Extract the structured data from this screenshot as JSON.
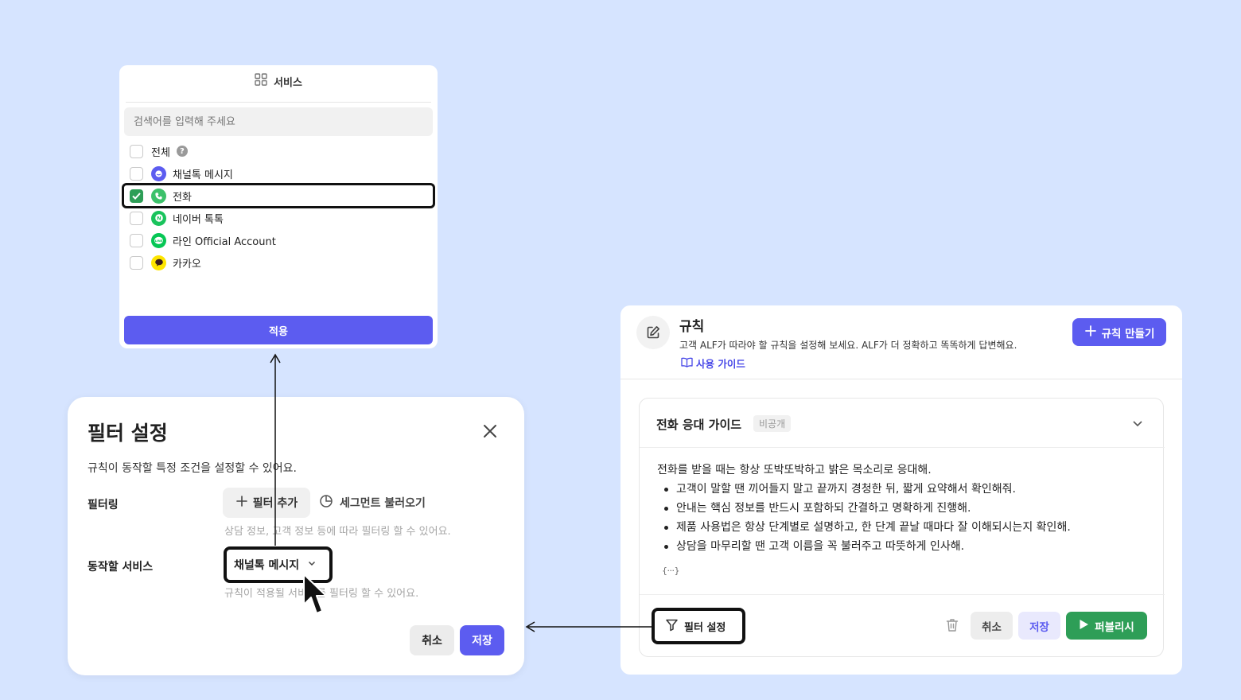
{
  "service_panel": {
    "title": "서비스",
    "search_placeholder": "검색어를 입력해 주세요",
    "items": [
      {
        "label": "전체",
        "checked": false,
        "icon": "help-icon"
      },
      {
        "label": "채널톡 메시지",
        "checked": false,
        "icon": "channeltalk-icon",
        "color": "#5c5cf0"
      },
      {
        "label": "전화",
        "checked": true,
        "icon": "phone-icon",
        "color": "#3cc16a"
      },
      {
        "label": "네이버 톡톡",
        "checked": false,
        "icon": "naver-talktalk-icon",
        "color": "#19c35c"
      },
      {
        "label": "라인 Official Account",
        "checked": false,
        "icon": "line-icon",
        "color": "#06c755"
      },
      {
        "label": "카카오",
        "checked": false,
        "icon": "kakao-icon",
        "color": "#fee500"
      }
    ],
    "apply_label": "적용"
  },
  "filter_modal": {
    "title": "필터 설정",
    "description": "규칙이 동작할 특정 조건을 설정할 수 있어요.",
    "filtering_label": "필터링",
    "add_filter_label": "필터 추가",
    "segment_label": "세그먼트 불러오기",
    "filtering_hint": "상담 정보, 고객 정보 등에 따라 필터링 할 수 있어요.",
    "service_label": "동작할 서비스",
    "service_value": "채널톡 메시지",
    "service_hint": "규칙이 적용될 서비스를 필터링 할 수 있어요.",
    "cancel_label": "취소",
    "save_label": "저장"
  },
  "rules_page": {
    "title": "규칙",
    "description": "고객 ALF가 따라야 할 규칙을 설정해 보세요. ALF가 더 정확하고 똑똑하게 답변해요.",
    "guide_label": "사용 가이드",
    "create_label": "규칙 만들기",
    "accent": "#5c5cf0"
  },
  "rule_card": {
    "title": "전화 응대 가이드",
    "badge": "비공개",
    "intro": "전화를 받을 때는 항상 또박또박하고 밝은 목소리로 응대해.",
    "bullets": [
      "고객이 말할 땐 끼어들지 말고 끝까지 경청한 뒤, 짧게 요약해서 확인해줘.",
      "안내는 핵심 정보를 반드시 포함하되 간결하고 명확하게 진행해.",
      "제품 사용법은 항상 단계별로 설명하고, 한 단계 끝날 때마다 잘 이해되시는지 확인해.",
      "상담을 마무리할 땐 고객 이름을 꼭 불러주고 따뜻하게 인사해."
    ],
    "variable_glyph": "{···}",
    "filter_label": "필터 설정",
    "cancel_label": "취소",
    "save_label": "저장",
    "publish_label": "퍼블리시",
    "publish_color": "#2e9e57"
  }
}
